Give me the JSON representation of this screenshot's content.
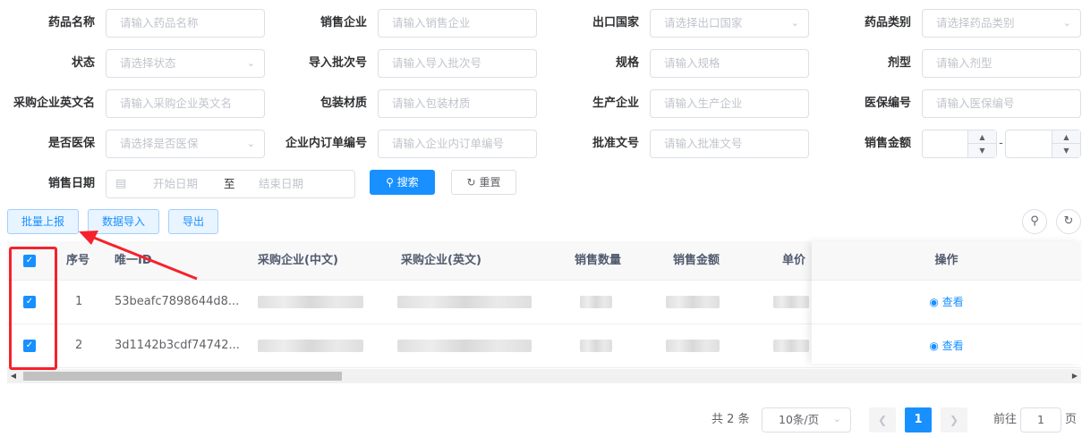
{
  "filters": {
    "drug_name": {
      "label": "药品名称",
      "placeholder": "请输入药品名称"
    },
    "sales_company": {
      "label": "销售企业",
      "placeholder": "请输入销售企业"
    },
    "export_country": {
      "label": "出口国家",
      "placeholder": "请选择出口国家"
    },
    "drug_category": {
      "label": "药品类别",
      "placeholder": "请选择药品类别"
    },
    "status": {
      "label": "状态",
      "placeholder": "请选择状态"
    },
    "import_batch": {
      "label": "导入批次号",
      "placeholder": "请输入导入批次号"
    },
    "spec": {
      "label": "规格",
      "placeholder": "请输入规格"
    },
    "dosage_form": {
      "label": "剂型",
      "placeholder": "请输入剂型"
    },
    "buyer_en": {
      "label": "采购企业英文名",
      "placeholder": "请输入采购企业英文名"
    },
    "packaging": {
      "label": "包装材质",
      "placeholder": "请输入包装材质"
    },
    "manufacturer": {
      "label": "生产企业",
      "placeholder": "请输入生产企业"
    },
    "insurance_code": {
      "label": "医保编号",
      "placeholder": "请输入医保编号"
    },
    "is_insurance": {
      "label": "是否医保",
      "placeholder": "请选择是否医保"
    },
    "internal_order": {
      "label": "企业内订单编号",
      "placeholder": "请输入企业内订单编号"
    },
    "approval_no": {
      "label": "批准文号",
      "placeholder": "请输入批准文号"
    },
    "sales_amount": {
      "label": "销售金额",
      "separator": "-"
    },
    "sales_date": {
      "label": "销售日期",
      "start_placeholder": "开始日期",
      "to": "至",
      "end_placeholder": "结束日期"
    }
  },
  "actions": {
    "search": "搜索",
    "reset": "重置",
    "batch_report": "批量上报",
    "data_import": "数据导入",
    "export": "导出"
  },
  "table": {
    "columns": {
      "index": "序号",
      "uid": "唯一ID",
      "buyer_cn": "采购企业(中文)",
      "buyer_en": "采购企业(英文)",
      "qty": "销售数量",
      "amount": "销售金额",
      "unit_price": "单价",
      "ops": "操作"
    },
    "rows": [
      {
        "index": "1",
        "uid": "53beafc7898644d8...",
        "op_label": "查看",
        "checked": true
      },
      {
        "index": "2",
        "uid": "3d1142b3cdf74742...",
        "op_label": "查看",
        "checked": true
      }
    ]
  },
  "pagination": {
    "total": "共 2 条",
    "page_size": "10条/页",
    "current_page": "1",
    "goto_prefix": "前往",
    "goto_value": "1",
    "goto_suffix": "页"
  },
  "colors": {
    "primary": "#1890ff",
    "highlight": "#f5222d"
  },
  "icons": {
    "search": "search-icon",
    "refresh": "refresh-icon",
    "calendar": "calendar-icon",
    "view": "eye-icon"
  }
}
